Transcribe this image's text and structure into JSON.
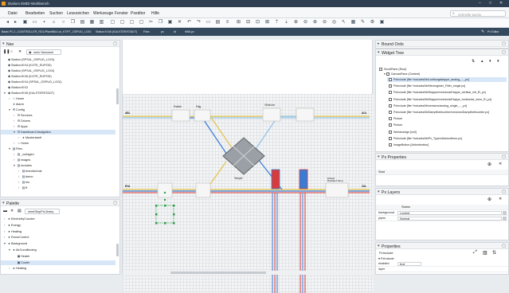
{
  "title_bar": {
    "title": "Dialium EMDI-Workbench",
    "min": "–",
    "max": "□",
    "close": "✕"
  },
  "menu": {
    "items": [
      "Datei",
      "Bearbeiten",
      "Suchen",
      "Lesezeichen",
      "Werkzeuge",
      "Fenster",
      "Pxeditor",
      "Hilfe"
    ]
  },
  "search": {
    "placeholder": "Schnelle Suche"
  },
  "address_bar": {
    "segments": [
      "Basis PC,1,,CONTROLLER_ROL/Plant/Bld.Lst_KTIFT_OSPUG_LOGI",
      "Station:KIX6 (KALSTER/STADT)",
      "Files",
      "px",
      "td",
      "rfl68.px"
    ],
    "right_label": "Px Editor"
  },
  "nav": {
    "title": "Nav",
    "network_selector": "mein Netzwerk",
    "items": [
      {
        "label": "Station (SPS4L_OSPUG_LOGI)",
        "icon": "◆",
        "selected": false
      },
      {
        "label": "Station:KIX4 (KOTE_EUPOD)",
        "icon": "◆",
        "selected": false
      },
      {
        "label": "Station (SPS4L_OSPUG_LOGI)",
        "icon": "◆",
        "selected": false
      },
      {
        "label": "Station:KIX6 (KOTE_EUPOD)",
        "icon": "◆",
        "selected": false
      },
      {
        "label": "Station:KIX4 (SPS4L_OSPUG_LOGI)",
        "icon": "◆",
        "selected": false
      },
      {
        "label": "Station:KIX2",
        "icon": "◆",
        "selected": false
      },
      {
        "label": "Station:KIX6 (KALSTERSTADT)",
        "icon": "◆",
        "selected": false
      },
      {
        "label": "Home",
        "icon": "⌂",
        "selected": false
      },
      {
        "label": "Alarm",
        "icon": "♦",
        "selected": false
      },
      {
        "label": "Config",
        "icon": "⚙",
        "selected": false
      },
      {
        "label": "Services",
        "icon": "⚙",
        "selected": false
      },
      {
        "label": "Drivers",
        "icon": "⚙",
        "selected": false
      },
      {
        "label": "Apps",
        "icon": "⚙",
        "selected": false
      },
      {
        "label": "Dashboard-Navigation",
        "icon": "⚙",
        "selected": true
      },
      {
        "label": "Musterstadt",
        "icon": "●",
        "selected": false
      },
      {
        "label": "Home",
        "icon": "⌂",
        "selected": false
      },
      {
        "label": "Files",
        "icon": "▤",
        "selected": false
      },
      {
        "label": "_vorlagen",
        "icon": "▤",
        "selected": false
      },
      {
        "label": "images",
        "icon": "▤",
        "selected": false
      },
      {
        "label": "includes",
        "icon": "▤",
        "selected": false
      },
      {
        "label": "brandschutz",
        "icon": "▤",
        "selected": false
      },
      {
        "label": "demo",
        "icon": "▤",
        "selected": false
      },
      {
        "label": "elo",
        "icon": "▤",
        "selected": false
      },
      {
        "label": "ff",
        "icon": "▤",
        "selected": false
      }
    ]
  },
  "palette": {
    "title": "Palette",
    "library": "meetStopPxLibrary",
    "items": [
      {
        "label": "ElectricityCounter",
        "icon": "●",
        "selected": false
      },
      {
        "label": "Energy",
        "icon": "●",
        "selected": false
      },
      {
        "label": "Heating",
        "icon": "●",
        "selected": false
      },
      {
        "label": "RoomControl",
        "icon": "●",
        "selected": false
      },
      {
        "label": "Background",
        "icon": "●",
        "selected": false
      },
      {
        "label": "AirConditioning",
        "icon": "●",
        "selected": false
      },
      {
        "label": "Heater",
        "icon": "▣",
        "selected": false
      },
      {
        "label": "Cooler",
        "icon": "▣",
        "selected": true
      },
      {
        "label": "Heating",
        "icon": "●",
        "selected": false
      }
    ]
  },
  "canvas": {
    "labels": {
      "top1": "Panbin",
      "top2": "Flag",
      "top3": "VKdeLen",
      "left1": "ABL",
      "left2": "EVA",
      "right1": "AUL",
      "right2": "ZUL",
      "mid": "Tempel",
      "status": "Einlauf\nRücklauf Temp"
    }
  },
  "bound_ords": {
    "title": "Bound Ords"
  },
  "widget_tree": {
    "title": "Widget Tree",
    "root": "ScrollPane (Root)",
    "canvas_pane": "CanvasPane (Content)",
    "items": [
      {
        "label": "PxInclude [file:^includes/lib/Lueftungsklappe_analog_..._px]",
        "selected": true
      },
      {
        "label": "PxInclude [file:^includes/lib/Heizregister_Filter_single.px]",
        "selected": false
      },
      {
        "label": "PxInclude [file:^includes/lib/Klappen/versions/Klappe_vertikal_mit_El_px]",
        "selected": false
      },
      {
        "label": "PxInclude [file:^includes/lib/Klappen/versions/Klappe_horizontal_ohne_El_px]",
        "selected": false
      },
      {
        "label": "PxInclude [file:^includes/lib/versions/analog_single_..._px]",
        "selected": false
      },
      {
        "label": "PxInclude [file:^includes/lib/Dampfbefeuchter/versions/Dampfbefeuchter.px]",
        "selected": false
      },
      {
        "label": "Picture",
        "selected": false
      },
      {
        "label": "Picture",
        "selected": false
      },
      {
        "label": "Wertanzeige [null]",
        "selected": false
      },
      {
        "label": "PxInclude [file:^includes/lib/Px_Typen/Antwortform.px]",
        "selected": false
      },
      {
        "label": "ImageButton [Abfuhrbutton]",
        "selected": false
      }
    ]
  },
  "px_properties": {
    "title": "Px Properties",
    "add": "⊕",
    "close": "✕",
    "columns": [
      "Start",
      ""
    ]
  },
  "px_layers": {
    "title": "Px Layers",
    "add": "⊕",
    "close": "✕",
    "header": "Status",
    "rows": [
      {
        "key": "background",
        "value": "Locked"
      },
      {
        "key": "pipes",
        "value": "Normal"
      }
    ]
  },
  "properties": {
    "title": "Properties",
    "type": "PxInclude",
    "node": "PxInclude",
    "rows": [
      {
        "key": "enabled",
        "value": "true"
      },
      {
        "key": "layer",
        "value": ""
      }
    ]
  },
  "colors": {
    "accent": "#2f3e50",
    "selection": "#d8e7f8",
    "pipe_blue": "#3a7bd5",
    "pipe_red": "#d83b3b",
    "pipe_yellow": "#e5c44a",
    "pipe_light": "#8fc3e8"
  }
}
